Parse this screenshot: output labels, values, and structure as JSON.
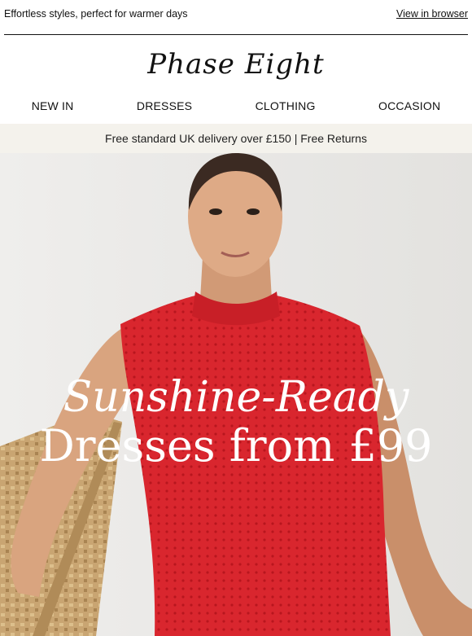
{
  "preheader": {
    "tagline": "Effortless styles, perfect for warmer days",
    "view_in_browser": "View in browser"
  },
  "brand": {
    "name": "Phase Eight"
  },
  "nav": {
    "items": [
      {
        "label": "NEW IN"
      },
      {
        "label": "DRESSES"
      },
      {
        "label": "CLOTHING"
      },
      {
        "label": "OCCASION"
      }
    ]
  },
  "banner": {
    "text": "Free standard UK delivery over £150 | Free Returns"
  },
  "hero": {
    "line1": "Sunshine-Ready",
    "line2": "Dresses from £99",
    "colors": {
      "dress": "#d9262e",
      "text": "#ffffff",
      "chair": "#c9a572"
    }
  }
}
